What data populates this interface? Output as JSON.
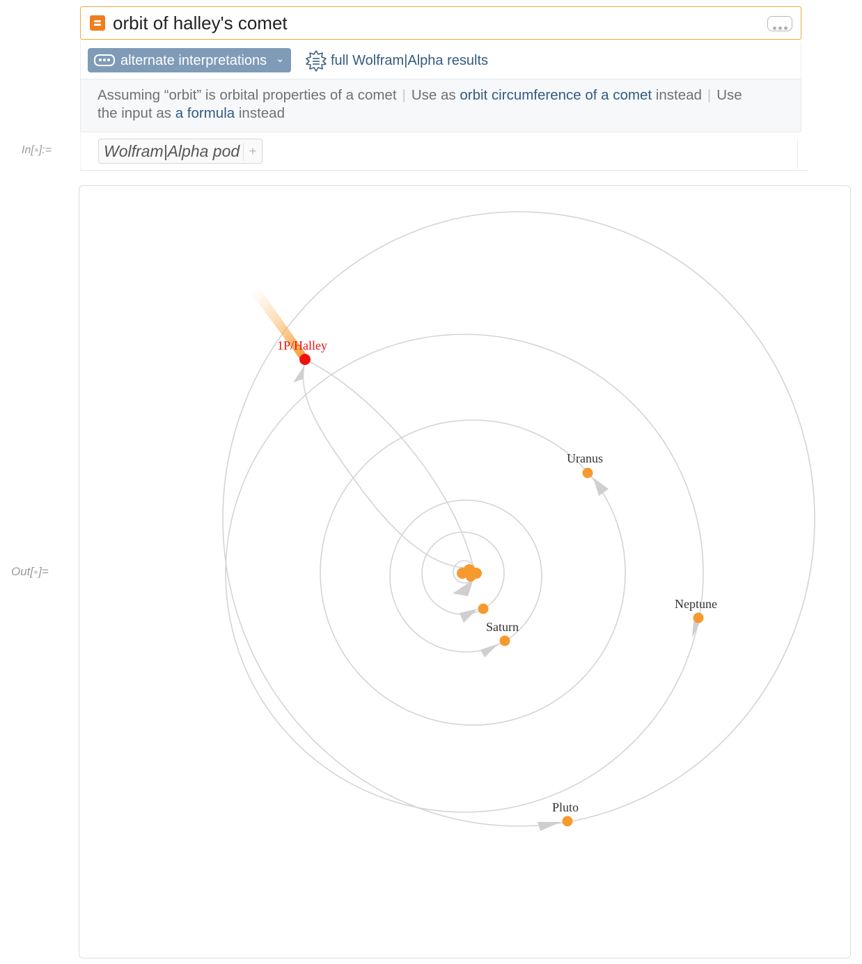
{
  "query": {
    "text": "orbit of halley's comet",
    "icon": "wolfram-input-icon",
    "more_icon": "ellipsis-icon"
  },
  "toolbar": {
    "alternate_label": "alternate interpretations",
    "alternate_chevron": "⌄",
    "full_results_label": "full Wolfram|Alpha results",
    "full_results_icon": "wolfram-star-icon"
  },
  "assumption": {
    "part1": "Assuming “orbit” is orbital properties of a comet",
    "sep": "|",
    "use_as": "Use as ",
    "alt1_link": "orbit circumference of a comet",
    "instead": " instead",
    "use2": "Use",
    "the_input_as": "the input as ",
    "alt2_link": "a formula",
    "instead2": " instead"
  },
  "cell": {
    "in_prefix": "In[",
    "in_suffix": "]:=",
    "out_prefix": "Out[",
    "out_suffix": "]=",
    "pod_label": "Wolfram|Alpha pod",
    "pod_plus": "+"
  },
  "orbit_plot": {
    "comet_label": "1P/Halley",
    "planet_labels": [
      "Uranus",
      "Saturn",
      "Neptune",
      "Pluto"
    ],
    "colors": {
      "comet": "#ee1111",
      "planet": "#f7992e",
      "orbit": "#d4d4d4",
      "arrow": "#c9c9c9",
      "tail": "#f9a33c"
    }
  }
}
